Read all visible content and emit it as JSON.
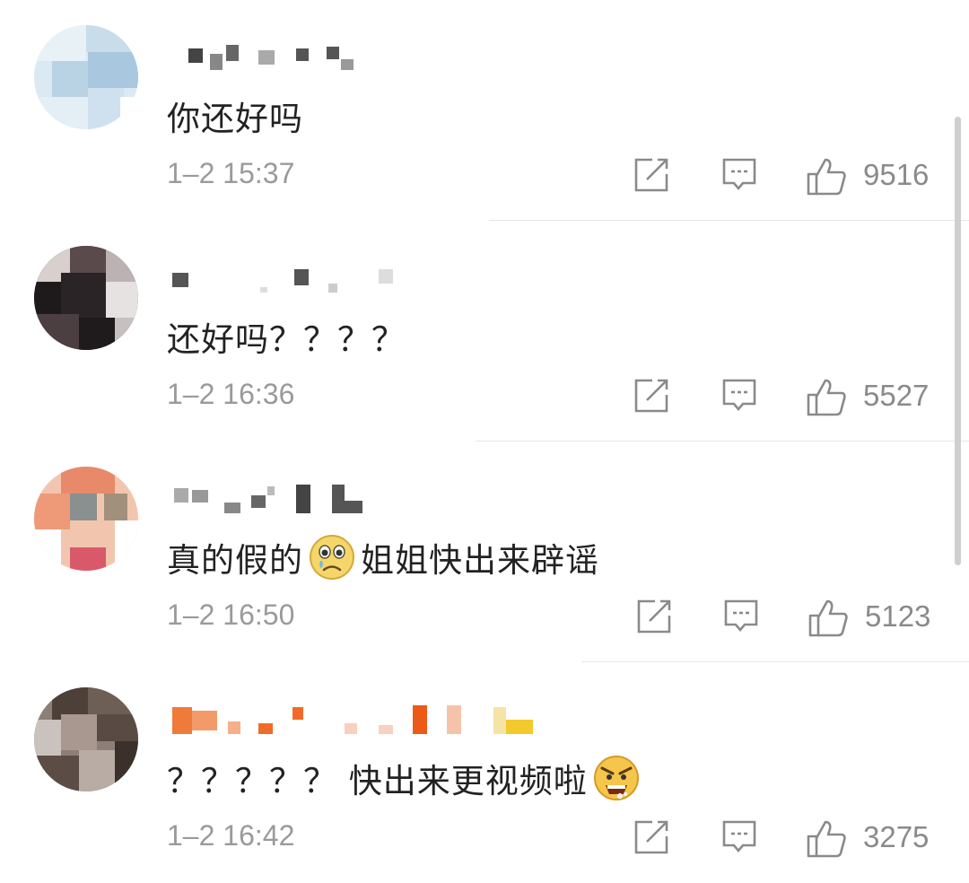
{
  "comments": [
    {
      "text": "你还好吗",
      "time": "1–2 15:37",
      "likes": "9516"
    },
    {
      "text_a": "还好吗？？？？",
      "time": "1–2 16:36",
      "likes": "5527"
    },
    {
      "text_a": "真的假的",
      "emoji": "crying-face-emoji",
      "text_b": "姐姐快出来辟谣",
      "time": "1–2 16:50",
      "likes": "5123"
    },
    {
      "text_a": "？？？？？ 快出来更视频啦",
      "emoji": "angry-face-emoji",
      "time": "1–2 16:42",
      "likes": "3275"
    }
  ],
  "colors": {
    "text": "#222222",
    "meta": "#9a9a9a",
    "icon": "#8a8a8a",
    "divider": "#e6e6e6"
  }
}
